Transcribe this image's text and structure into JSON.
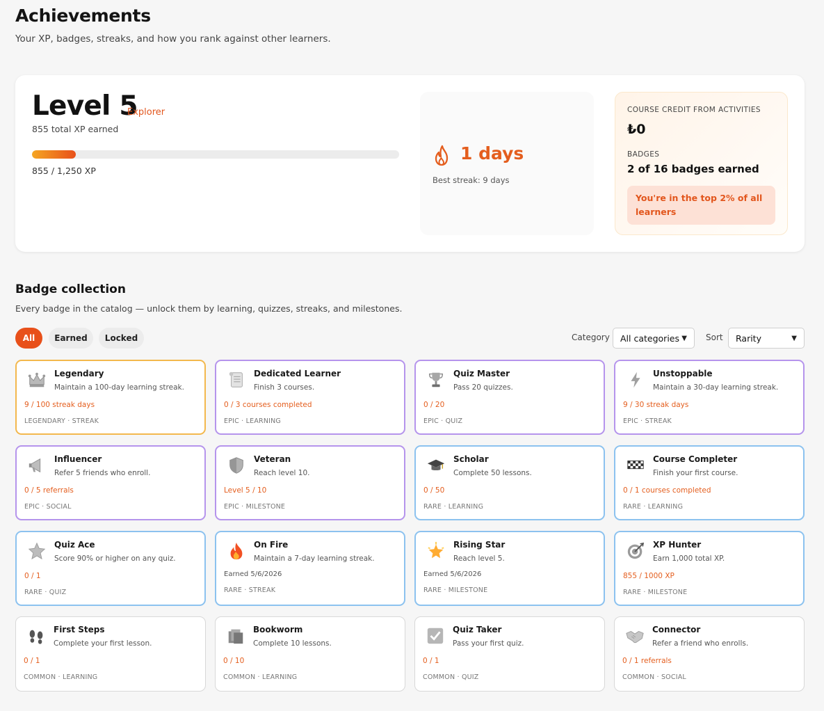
{
  "header": {
    "title": "Achievements",
    "subtitle": "Your XP, badges, streaks, and how you rank against other learners."
  },
  "level": {
    "title": "Level 5",
    "rank": "Explorer",
    "total_xp": "855 total XP earned",
    "xp_progress_fraction": 0.12,
    "xp_label": "855 / 1,250 XP"
  },
  "streak": {
    "value": "1 days",
    "best": "Best streak: 9 days",
    "icon": "flame-icon"
  },
  "credit": {
    "label": "COURSE CREDIT FROM ACTIVITIES",
    "value": "₺0",
    "badges_label": "BADGES",
    "badges_value": "2 of 16 badges earned",
    "rank_message": "You're in the top 2% of all learners"
  },
  "collection": {
    "title": "Badge collection",
    "subtitle": "Every badge in the catalog — unlock them by learning, quizzes, streaks, and milestones.",
    "filters": [
      "All",
      "Earned",
      "Locked"
    ],
    "active_filter": "All",
    "category_label": "Category",
    "category_value": "All categories",
    "sort_label": "Sort",
    "sort_value": "Rarity"
  },
  "badges": [
    {
      "name": "Legendary",
      "desc": "Maintain a 100-day learning streak.",
      "progress": "9 / 100 streak days",
      "meta": "LEGENDARY · STREAK",
      "rarity": "legendary",
      "icon": "crown-icon",
      "earned": false
    },
    {
      "name": "Dedicated Learner",
      "desc": "Finish 3 courses.",
      "progress": "0 / 3 courses completed",
      "meta": "EPIC · LEARNING",
      "rarity": "epic",
      "icon": "scroll-icon",
      "earned": false
    },
    {
      "name": "Quiz Master",
      "desc": "Pass 20 quizzes.",
      "progress": "0 / 20",
      "meta": "EPIC · QUIZ",
      "rarity": "epic",
      "icon": "trophy-icon",
      "earned": false
    },
    {
      "name": "Unstoppable",
      "desc": "Maintain a 30-day learning streak.",
      "progress": "9 / 30 streak days",
      "meta": "EPIC · STREAK",
      "rarity": "epic",
      "icon": "lightning-icon",
      "earned": false
    },
    {
      "name": "Influencer",
      "desc": "Refer 5 friends who enroll.",
      "progress": "0 / 5 referrals",
      "meta": "EPIC · SOCIAL",
      "rarity": "epic",
      "icon": "megaphone-icon",
      "earned": false
    },
    {
      "name": "Veteran",
      "desc": "Reach level 10.",
      "progress": "Level 5 / 10",
      "meta": "EPIC · MILESTONE",
      "rarity": "epic",
      "icon": "shield-icon",
      "earned": false
    },
    {
      "name": "Scholar",
      "desc": "Complete 50 lessons.",
      "progress": "0 / 50",
      "meta": "RARE · LEARNING",
      "rarity": "rare",
      "icon": "graduation-cap-icon",
      "earned": false
    },
    {
      "name": "Course Completer",
      "desc": "Finish your first course.",
      "progress": "0 / 1 courses completed",
      "meta": "RARE · LEARNING",
      "rarity": "rare",
      "icon": "checkered-flag-icon",
      "earned": false
    },
    {
      "name": "Quiz Ace",
      "desc": "Score 90% or higher on any quiz.",
      "progress": "0 / 1",
      "meta": "RARE · QUIZ",
      "rarity": "rare",
      "icon": "star-icon",
      "earned": false
    },
    {
      "name": "On Fire",
      "desc": "Maintain a 7-day learning streak.",
      "progress": "Earned 5/6/2026",
      "meta": "RARE · STREAK",
      "rarity": "rare",
      "icon": "fire-icon",
      "earned": true
    },
    {
      "name": "Rising Star",
      "desc": "Reach level 5.",
      "progress": "Earned 5/6/2026",
      "meta": "RARE · MILESTONE",
      "rarity": "rare",
      "icon": "glowing-star-icon",
      "earned": true
    },
    {
      "name": "XP Hunter",
      "desc": "Earn 1,000 total XP.",
      "progress": "855 / 1000 XP",
      "meta": "RARE · MILESTONE",
      "rarity": "rare",
      "icon": "target-icon",
      "earned": false
    },
    {
      "name": "First Steps",
      "desc": "Complete your first lesson.",
      "progress": "0 / 1",
      "meta": "COMMON · LEARNING",
      "rarity": "common",
      "icon": "footprints-icon",
      "earned": false
    },
    {
      "name": "Bookworm",
      "desc": "Complete 10 lessons.",
      "progress": "0 / 10",
      "meta": "COMMON · LEARNING",
      "rarity": "common",
      "icon": "books-icon",
      "earned": false
    },
    {
      "name": "Quiz Taker",
      "desc": "Pass your first quiz.",
      "progress": "0 / 1",
      "meta": "COMMON · QUIZ",
      "rarity": "common",
      "icon": "checkbox-icon",
      "earned": false
    },
    {
      "name": "Connector",
      "desc": "Refer a friend who enrolls.",
      "progress": "0 / 1 referrals",
      "meta": "COMMON · SOCIAL",
      "rarity": "common",
      "icon": "handshake-icon",
      "earned": false
    }
  ],
  "colors": {
    "accent": "#e8501a",
    "legendary": "#f3b84d",
    "epic": "#b594ec",
    "rare": "#8cc2ef",
    "common": "#d8d8d8"
  }
}
